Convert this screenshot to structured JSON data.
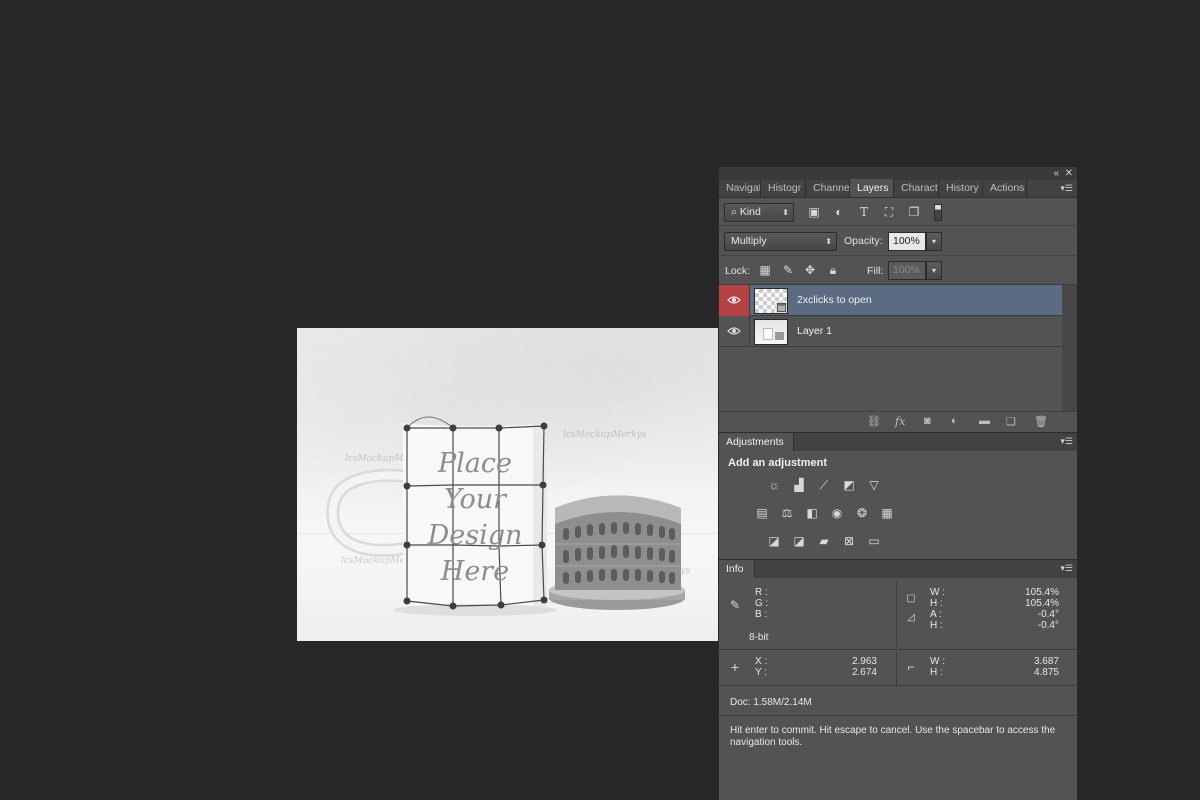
{
  "canvas": {
    "mockup_text": [
      "Place",
      "Your",
      "Design",
      "Here"
    ],
    "watermarks": [
      "lcsMockupMerkys",
      "lcsMockupMerkys",
      "lcsMockupMerkys",
      "lcsMockupMerkys",
      "lcsMockupMerkys"
    ]
  },
  "panel": {
    "tabs": [
      "Navigat",
      "Histogr",
      "Channel",
      "Layers",
      "Characte",
      "History",
      "Actions"
    ],
    "active_tab": "Layers",
    "filter_kind": "Kind",
    "blend_mode": "Multiply",
    "opacity_label": "Opacity:",
    "opacity_value": "100%",
    "lock_label": "Lock:",
    "fill_label": "Fill:",
    "fill_value": "100%",
    "layers": [
      {
        "name": "2xclicks to open",
        "selected": true
      },
      {
        "name": "Layer 1",
        "selected": false
      }
    ],
    "adjustments": {
      "title": "Adjustments",
      "subtitle": "Add an adjustment"
    },
    "info": {
      "title": "Info",
      "rgb_labels": [
        "R :",
        "G :",
        "B :"
      ],
      "bit_depth": "8-bit",
      "transform": [
        {
          "label": "W :",
          "value": "105.4%"
        },
        {
          "label": "H :",
          "value": "105.4%"
        },
        {
          "label": "A :",
          "value": "-0.4°"
        },
        {
          "label": "H :",
          "value": "-0.4°"
        }
      ],
      "x_label": "X :",
      "x_value": "2.963",
      "y_label": "Y :",
      "y_value": "2.674",
      "w_label": "W :",
      "w_value": "3.687",
      "h_label": "H :",
      "h_value": "4.875",
      "doc": "Doc: 1.58M/2.14M",
      "hint": "Hit enter to commit. Hit escape to cancel. Use the spacebar to access the navigation tools."
    }
  },
  "colors": {
    "workspace": "#282828",
    "panel": "#535353",
    "selected_layer": "#5a6b82",
    "eye_highlight": "#b54242"
  }
}
